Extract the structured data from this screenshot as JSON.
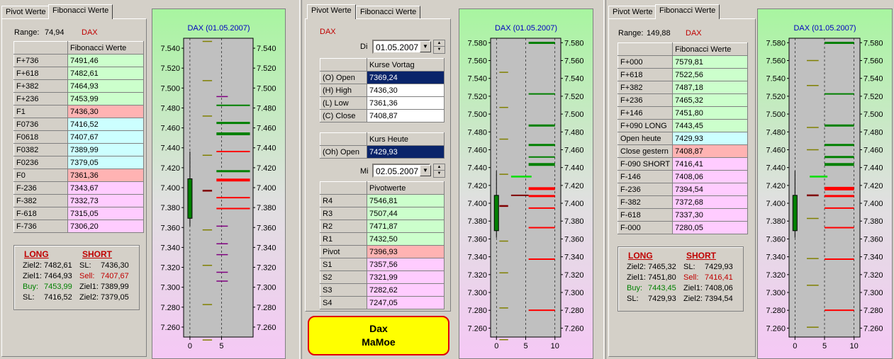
{
  "panel1": {
    "tabs": [
      "Pivot Werte",
      "Fibonacci Werte"
    ],
    "range_label": "Range:",
    "range_value": "74,94",
    "symbol": "DAX",
    "table_header": "Fibonacci Werte",
    "rows": [
      {
        "label": "F+736",
        "value": "7491,46",
        "color": "green"
      },
      {
        "label": "F+618",
        "value": "7482,61",
        "color": "green"
      },
      {
        "label": "F+382",
        "value": "7464,93",
        "color": "green"
      },
      {
        "label": "F+236",
        "value": "7453,99",
        "color": "green"
      },
      {
        "label": "F1",
        "value": "7436,30",
        "color": "red"
      },
      {
        "label": "F0736",
        "value": "7416,52",
        "color": "cyan"
      },
      {
        "label": "F0618",
        "value": "7407,67",
        "color": "cyan"
      },
      {
        "label": "F0382",
        "value": "7389,99",
        "color": "cyan"
      },
      {
        "label": "F0236",
        "value": "7379,05",
        "color": "cyan"
      },
      {
        "label": "F0",
        "value": "7361,36",
        "color": "red"
      },
      {
        "label": "F-236",
        "value": "7343,67",
        "color": "pink"
      },
      {
        "label": "F-382",
        "value": "7332,73",
        "color": "pink"
      },
      {
        "label": "F-618",
        "value": "7315,05",
        "color": "pink"
      },
      {
        "label": "F-736",
        "value": "7306,20",
        "color": "pink"
      }
    ],
    "long_title": "LONG",
    "short_title": "SHORT",
    "long": [
      {
        "k": "Ziel2:",
        "v": "7482,61",
        "color": ""
      },
      {
        "k": "Ziel1:",
        "v": "7464,93",
        "color": ""
      },
      {
        "k": "Buy:",
        "v": "7453,99",
        "color": "green"
      },
      {
        "k": "SL:",
        "v": "7416,52",
        "color": ""
      }
    ],
    "short": [
      {
        "k": "SL:",
        "v": "7436,30",
        "color": ""
      },
      {
        "k": "Sell:",
        "v": "7407,67",
        "color": "red"
      },
      {
        "k": "Ziel1:",
        "v": "7389,99",
        "color": ""
      },
      {
        "k": "Ziel2:",
        "v": "7379,05",
        "color": ""
      }
    ]
  },
  "panel2": {
    "tabs": [
      "Pivot Werte",
      "Fibonacci Werte"
    ],
    "symbol": "DAX",
    "day1_label": "Di",
    "day1_date": "01.05.2007",
    "table1_header": "Kurse Vortag",
    "table1": [
      {
        "label": "(O) Open",
        "value": "7369,24",
        "selected": true
      },
      {
        "label": "(H) High",
        "value": "7436,30",
        "selected": false
      },
      {
        "label": "(L) Low",
        "value": "7361,36",
        "selected": false
      },
      {
        "label": "(C) Close",
        "value": "7408,87",
        "selected": false
      }
    ],
    "table2_header": "Kurs Heute",
    "table2": [
      {
        "label": "(Oh) Open",
        "value": "7429,93",
        "selected": true
      }
    ],
    "day2_label": "Mi",
    "day2_date": "02.05.2007",
    "table3_header": "Pivotwerte",
    "table3": [
      {
        "label": "R4",
        "value": "7546,81",
        "color": "green"
      },
      {
        "label": "R3",
        "value": "7507,44",
        "color": "green"
      },
      {
        "label": "R2",
        "value": "7471,87",
        "color": "green"
      },
      {
        "label": "R1",
        "value": "7432,50",
        "color": "green"
      },
      {
        "label": "Pivot",
        "value": "7396,93",
        "color": "red"
      },
      {
        "label": "S1",
        "value": "7357,56",
        "color": "pink"
      },
      {
        "label": "S2",
        "value": "7321,99",
        "color": "pink"
      },
      {
        "label": "S3",
        "value": "7282,62",
        "color": "pink"
      },
      {
        "label": "S4",
        "value": "7247,05",
        "color": "pink"
      }
    ],
    "logo_line1": "Dax",
    "logo_line2": "MaMoe"
  },
  "panel3": {
    "tabs": [
      "Pivot Werte",
      "Fibonacci Werte"
    ],
    "range_label": "Range:",
    "range_value": "149,88",
    "symbol": "DAX",
    "table_header": "Fibonacci Werte",
    "rows": [
      {
        "label": "F+000",
        "value": "7579,81",
        "color": "green"
      },
      {
        "label": "F+618",
        "value": "7522,56",
        "color": "green"
      },
      {
        "label": "F+382",
        "value": "7487,18",
        "color": "green"
      },
      {
        "label": "F+236",
        "value": "7465,32",
        "color": "green"
      },
      {
        "label": "F+146",
        "value": "7451,80",
        "color": "green"
      },
      {
        "label": "F+090 LONG",
        "value": "7443,45",
        "color": "green"
      },
      {
        "label": "Open heute",
        "value": "7429,93",
        "color": "cyan"
      },
      {
        "label": "Close gestern",
        "value": "7408,87",
        "color": "red"
      },
      {
        "label": "F-090 SHORT",
        "value": "7416,41",
        "color": "pink"
      },
      {
        "label": "F-146",
        "value": "7408,06",
        "color": "pink"
      },
      {
        "label": "F-236",
        "value": "7394,54",
        "color": "pink"
      },
      {
        "label": "F-382",
        "value": "7372,68",
        "color": "pink"
      },
      {
        "label": "F-618",
        "value": "7337,30",
        "color": "pink"
      },
      {
        "label": "F-000",
        "value": "7280,05",
        "color": "pink"
      }
    ],
    "long_title": "LONG",
    "short_title": "SHORT",
    "long": [
      {
        "k": "Ziel2:",
        "v": "7465,32",
        "color": ""
      },
      {
        "k": "Ziel1:",
        "v": "7451,80",
        "color": ""
      },
      {
        "k": "Buy:",
        "v": "7443,45",
        "color": "green"
      },
      {
        "k": "SL:",
        "v": "7429,93",
        "color": ""
      }
    ],
    "short": [
      {
        "k": "SL:",
        "v": "7429,93",
        "color": ""
      },
      {
        "k": "Sell:",
        "v": "7416,41",
        "color": "red"
      },
      {
        "k": "Ziel1:",
        "v": "7408,06",
        "color": ""
      },
      {
        "k": "Ziel2:",
        "v": "7394,54",
        "color": ""
      }
    ]
  },
  "chart_data": [
    {
      "type": "line",
      "title": "DAX    (01.05.2007)",
      "ylim": [
        7250,
        7550
      ],
      "y_ticks": [
        "7.260",
        "7.280",
        "7.300",
        "7.320",
        "7.340",
        "7.360",
        "7.380",
        "7.400",
        "7.420",
        "7.440",
        "7.460",
        "7.480",
        "7.500",
        "7.520",
        "7.540"
      ],
      "x_ticks": [
        "0",
        "5"
      ],
      "xlim": [
        -1,
        10
      ],
      "candle": {
        "x": 0,
        "open": 7369.24,
        "high": 7436.3,
        "low": 7361.36,
        "close": 7408.87
      },
      "pivot_mark": {
        "x": [
          2,
          3.5
        ],
        "y": 7396.93,
        "color": "#800000"
      },
      "olive_marks": {
        "x": [
          2,
          3.5
        ],
        "y": [
          7546.81,
          7507.44,
          7471.87,
          7432.5,
          7357.56,
          7321.99,
          7282.62,
          7247.05
        ],
        "color": "#808000"
      },
      "purple_marks": {
        "x": [
          4.2,
          6
        ],
        "y": [
          7491.46,
          7361.36,
          7343.67,
          7332.73,
          7315.05,
          7306.2
        ],
        "color": "#800080"
      },
      "green_levels": {
        "x": [
          4.2,
          9.5
        ],
        "y": [
          7482.61,
          7464.93,
          7453.99,
          7416.52
        ],
        "widths": [
          2,
          3,
          4,
          3
        ],
        "color": "#008000"
      },
      "red_levels": {
        "x": [
          4.2,
          9.5
        ],
        "y": [
          7436.3,
          7407.67,
          7389.99,
          7379.05
        ],
        "widths": [
          2,
          4,
          2,
          2
        ],
        "color": "#ff0000"
      }
    },
    {
      "type": "line",
      "title": "DAX    (01.05.2007)",
      "ylim": [
        7250,
        7585
      ],
      "y_ticks": [
        "7.260",
        "7.280",
        "7.300",
        "7.320",
        "7.340",
        "7.360",
        "7.380",
        "7.400",
        "7.420",
        "7.440",
        "7.460",
        "7.480",
        "7.500",
        "7.520",
        "7.540",
        "7.560",
        "7.580"
      ],
      "x_ticks": [
        "0",
        "5",
        "10"
      ],
      "xlim": [
        -1,
        11
      ],
      "candle": {
        "x": 0,
        "open": 7369.24,
        "high": 7436.3,
        "low": 7361.36,
        "close": 7408.87
      },
      "pivot_mark": {
        "x": [
          0.5,
          2
        ],
        "y": 7396.93,
        "color": "#800000"
      },
      "olive_marks": {
        "x": [
          0.5,
          2
        ],
        "y": [
          7546.81,
          7507.44,
          7471.87,
          7432.5,
          7357.56,
          7321.99,
          7282.62,
          7247.05
        ],
        "color": "#808000"
      },
      "dark_red_mark": {
        "x": [
          2.5,
          5.5
        ],
        "y": 7408.87,
        "color": "#800000"
      },
      "bright_green_mark": {
        "x": [
          2.5,
          6
        ],
        "y": 7429.93,
        "color": "#00e000"
      },
      "green_levels": {
        "x": [
          5.5,
          10
        ],
        "y": [
          7579.81,
          7522.56,
          7487.18,
          7465.32,
          7451.8,
          7443.45
        ],
        "widths": [
          3,
          2,
          3,
          3,
          2,
          4
        ],
        "color": "#008000"
      },
      "red_levels": {
        "x": [
          5.5,
          10
        ],
        "y": [
          7416.41,
          7408.06,
          7394.54,
          7372.68,
          7337.3,
          7280.05
        ],
        "widths": [
          4,
          3,
          2,
          2,
          2,
          2
        ],
        "color": "#ff0000"
      }
    },
    {
      "type": "line",
      "title": "DAX    (01.05.2007)",
      "ylim": [
        7250,
        7585
      ],
      "y_ticks": [
        "7.260",
        "7.280",
        "7.300",
        "7.320",
        "7.340",
        "7.360",
        "7.380",
        "7.400",
        "7.420",
        "7.440",
        "7.460",
        "7.480",
        "7.500",
        "7.520",
        "7.540",
        "7.560",
        "7.580"
      ],
      "x_ticks": [
        "0",
        "5",
        "10"
      ],
      "xlim": [
        -1,
        11
      ],
      "candle": {
        "x": 0,
        "open": 7369.24,
        "high": 7436.3,
        "low": 7361.36,
        "close": 7408.87
      },
      "pivot_mark": {
        "x": [
          2,
          4
        ],
        "y": 7408.87,
        "color": "#800000"
      },
      "olive_marks": {
        "x": [
          2,
          4
        ],
        "y": [
          7560,
          7532,
          7485,
          7460,
          7383,
          7338,
          7308,
          7261
        ],
        "color": "#808000"
      },
      "bright_green_mark": {
        "x": [
          2.5,
          5.5
        ],
        "y": 7429.93,
        "color": "#00e000"
      },
      "green_levels": {
        "x": [
          5,
          10
        ],
        "y": [
          7579.81,
          7522.56,
          7487.18,
          7465.32,
          7451.8,
          7443.45
        ],
        "widths": [
          3,
          2,
          3,
          3,
          3,
          4
        ],
        "color": "#008000"
      },
      "red_levels": {
        "x": [
          5,
          10
        ],
        "y": [
          7416.41,
          7408.06,
          7394.54,
          7372.68,
          7337.3,
          7280.05
        ],
        "widths": [
          5,
          3,
          2,
          2,
          2,
          2
        ],
        "color": "#ff0000"
      }
    }
  ]
}
